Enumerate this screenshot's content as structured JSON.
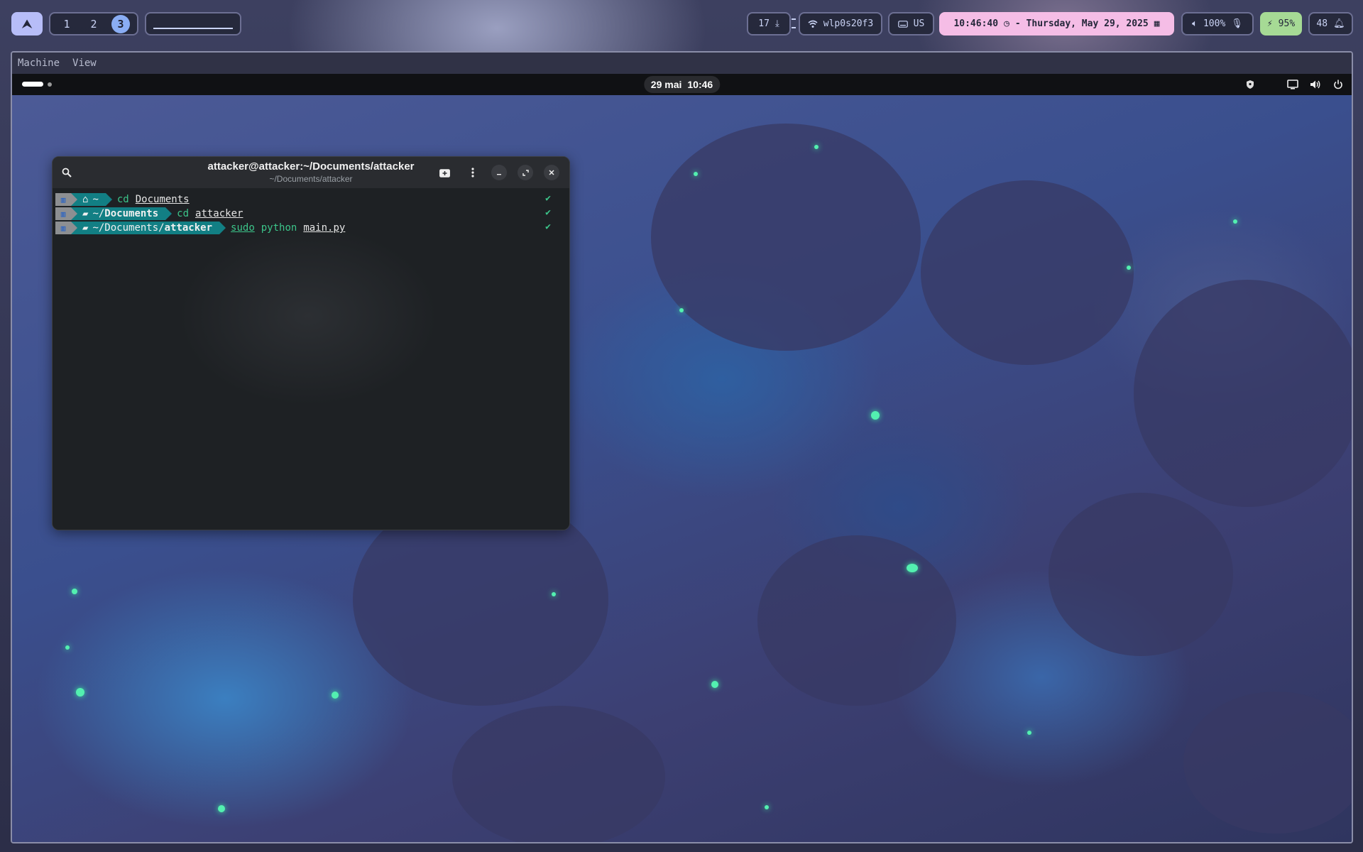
{
  "host_bar": {
    "launcher_icon": "arch-logo-icon",
    "workspaces": [
      "1",
      "2",
      "3"
    ],
    "active_workspace": "3",
    "downloads": "17",
    "wifi_name": "wlp0s20f3",
    "keyboard_layout": "US",
    "clock": "10:46:40",
    "date": "- Thursday, May 29, 2025",
    "volume": "100%",
    "battery": "95%",
    "notifications": "48",
    "colors": {
      "accent": "#b7bdf8",
      "clock_bg": "#f5bde6",
      "battery_bg": "#a6da95",
      "active_ws": "#8aadf4"
    }
  },
  "vm_window": {
    "menu": [
      "Machine",
      "View"
    ]
  },
  "guest_bar": {
    "date": "29 mai",
    "time": "10:46"
  },
  "terminal": {
    "title": "attacker@attacker:~/Documents/attacker",
    "subtitle": "~/Documents/attacker",
    "lines": [
      {
        "dir_icon": "home-icon",
        "dir_text": "~",
        "dir_bold": "",
        "cmd_word": "cd",
        "cmd_arg": "Documents",
        "status": "✔"
      },
      {
        "dir_icon": "folder-icon",
        "dir_text": "~/",
        "dir_bold": "Documents",
        "cmd_word": "cd",
        "cmd_arg": "attacker",
        "status": "✔"
      },
      {
        "dir_icon": "folder-icon",
        "dir_text": "~/Documents/",
        "dir_bold": "attacker",
        "cmd_sudo": "sudo",
        "cmd_word": "python",
        "cmd_arg": "main.py",
        "status": "✔"
      }
    ]
  }
}
